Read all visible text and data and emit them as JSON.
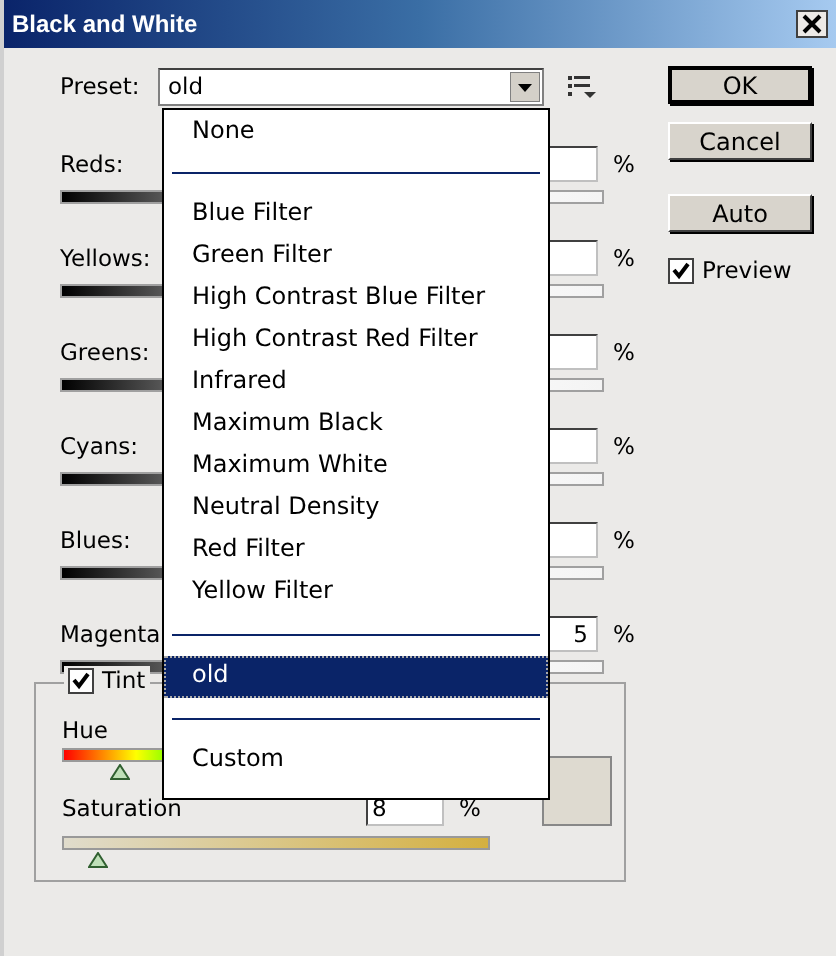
{
  "window": {
    "title": "Black and White"
  },
  "preset": {
    "label": "Preset:",
    "value": "old"
  },
  "dropdown": {
    "items": [
      {
        "kind": "option",
        "label": "None",
        "selected": false
      },
      {
        "kind": "separator"
      },
      {
        "kind": "option",
        "label": "Blue Filter",
        "selected": false
      },
      {
        "kind": "option",
        "label": "Green Filter",
        "selected": false
      },
      {
        "kind": "option",
        "label": "High Contrast Blue Filter",
        "selected": false
      },
      {
        "kind": "option",
        "label": "High Contrast Red Filter",
        "selected": false
      },
      {
        "kind": "option",
        "label": "Infrared",
        "selected": false
      },
      {
        "kind": "option",
        "label": "Maximum Black",
        "selected": false
      },
      {
        "kind": "option",
        "label": "Maximum White",
        "selected": false
      },
      {
        "kind": "option",
        "label": "Neutral Density",
        "selected": false
      },
      {
        "kind": "option",
        "label": "Red Filter",
        "selected": false
      },
      {
        "kind": "option",
        "label": "Yellow Filter",
        "selected": false
      },
      {
        "kind": "separator"
      },
      {
        "kind": "option",
        "label": "old",
        "selected": true
      },
      {
        "kind": "separator"
      },
      {
        "kind": "option",
        "label": "Custom",
        "selected": false
      }
    ]
  },
  "channels": [
    {
      "name": "Reds:",
      "unit": "%"
    },
    {
      "name": "Yellows:",
      "unit": "%"
    },
    {
      "name": "Greens:",
      "unit": "%"
    },
    {
      "name": "Cyans:",
      "unit": "%"
    },
    {
      "name": "Blues:",
      "unit": "%"
    },
    {
      "name": "Magenta",
      "value": "5",
      "unit": "%"
    }
  ],
  "tint": {
    "label": "Tint",
    "checked": true,
    "hue": {
      "label": "Hue",
      "level": 0.13
    },
    "saturation": {
      "label": "Saturation",
      "value": "8",
      "unit": "%",
      "level": 0.08
    }
  },
  "buttons": [
    "OK",
    "Cancel",
    "Auto"
  ],
  "preview": {
    "label": "Preview",
    "checked": true
  }
}
